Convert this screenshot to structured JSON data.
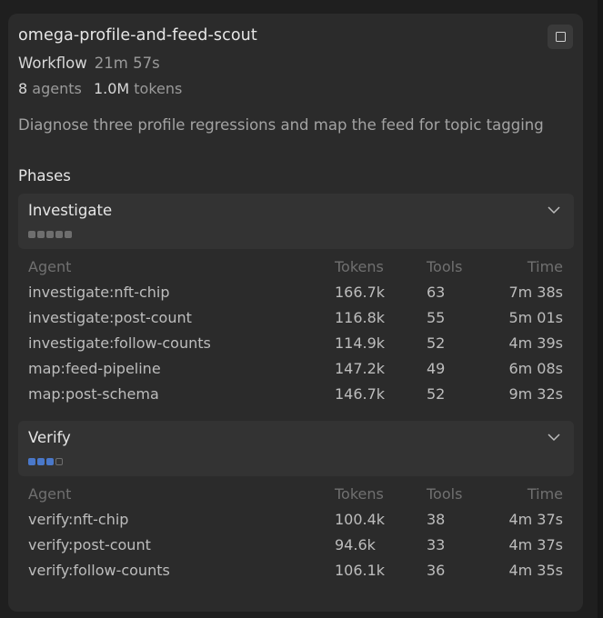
{
  "workflow": {
    "title": "omega-profile-and-feed-scout",
    "kind": "Workflow",
    "duration": "21m 57s",
    "agents_count": "8",
    "agents_label": "agents",
    "tokens_count": "1.0M",
    "tokens_label": "tokens",
    "description": "Diagnose three profile regressions and map the feed for topic tagging",
    "phases_label": "Phases"
  },
  "table_headers": {
    "agent": "Agent",
    "tokens": "Tokens",
    "tools": "Tools",
    "time": "Time"
  },
  "phases": [
    {
      "name": "Investigate",
      "progress": {
        "done": 5,
        "active": 0,
        "pending": 0
      },
      "rows": [
        {
          "agent": "investigate:nft-chip",
          "tokens": "166.7k",
          "tools": "63",
          "time": "7m 38s"
        },
        {
          "agent": "investigate:post-count",
          "tokens": "116.8k",
          "tools": "55",
          "time": "5m 01s"
        },
        {
          "agent": "investigate:follow-counts",
          "tokens": "114.9k",
          "tools": "52",
          "time": "4m 39s"
        },
        {
          "agent": "map:feed-pipeline",
          "tokens": "147.2k",
          "tools": "49",
          "time": "6m 08s"
        },
        {
          "agent": "map:post-schema",
          "tokens": "146.7k",
          "tools": "52",
          "time": "9m 32s"
        }
      ]
    },
    {
      "name": "Verify",
      "progress": {
        "done": 0,
        "active": 3,
        "pending": 1
      },
      "rows": [
        {
          "agent": "verify:nft-chip",
          "tokens": "100.4k",
          "tools": "38",
          "time": "4m 37s"
        },
        {
          "agent": "verify:post-count",
          "tokens": "94.6k",
          "tools": "33",
          "time": "4m 37s"
        },
        {
          "agent": "verify:follow-counts",
          "tokens": "106.1k",
          "tools": "36",
          "time": "4m 35s"
        }
      ]
    }
  ],
  "icons": {
    "stop": "stop-icon",
    "collapse": "chevron-down-icon"
  },
  "colors": {
    "progress_active": "#4a78c9",
    "progress_done": "#6e6e6e"
  }
}
